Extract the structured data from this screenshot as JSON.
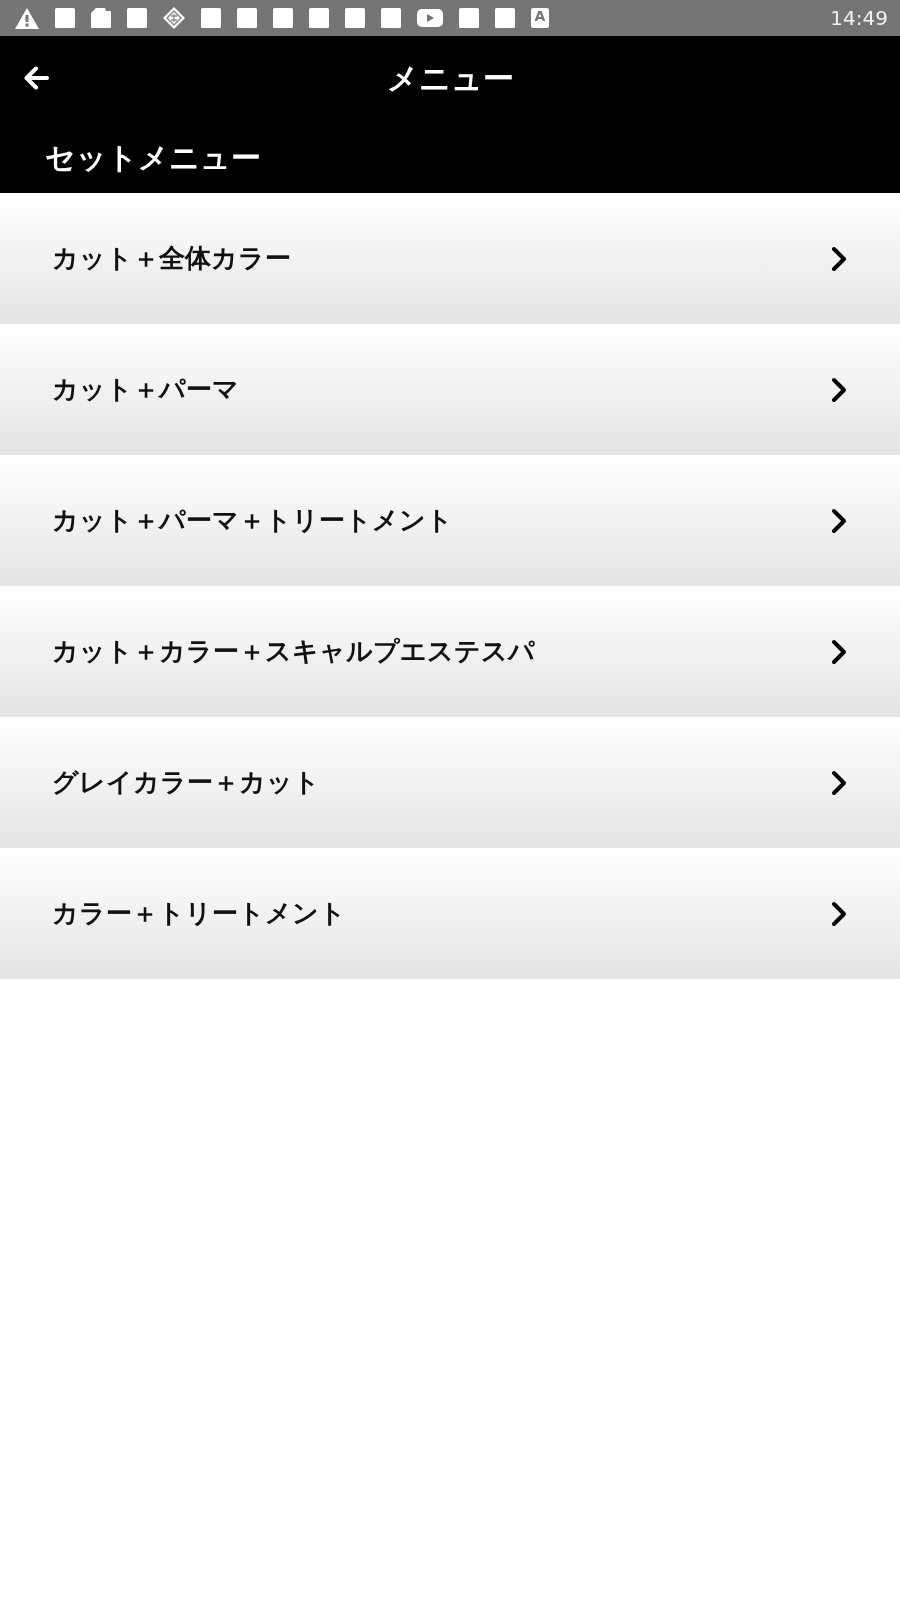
{
  "status_bar": {
    "icons": [
      {
        "kind": "warning"
      },
      {
        "kind": "square"
      },
      {
        "kind": "sd-card"
      },
      {
        "kind": "square"
      },
      {
        "kind": "diamond"
      },
      {
        "kind": "square"
      },
      {
        "kind": "square"
      },
      {
        "kind": "square"
      },
      {
        "kind": "square"
      },
      {
        "kind": "square"
      },
      {
        "kind": "square"
      },
      {
        "kind": "play"
      },
      {
        "kind": "square"
      },
      {
        "kind": "square"
      },
      {
        "kind": "letter",
        "label": "A"
      }
    ],
    "time": "14:49"
  },
  "header": {
    "title": "メニュー",
    "subtitle": "セットメニュー"
  },
  "menu_items": [
    {
      "label": "カット＋全体カラー"
    },
    {
      "label": "カット＋パーマ"
    },
    {
      "label": "カット＋パーマ＋トリートメント"
    },
    {
      "label": "カット＋カラー＋スキャルプエステスパ"
    },
    {
      "label": "グレイカラー＋カット"
    },
    {
      "label": "カラー＋トリートメント"
    }
  ]
}
